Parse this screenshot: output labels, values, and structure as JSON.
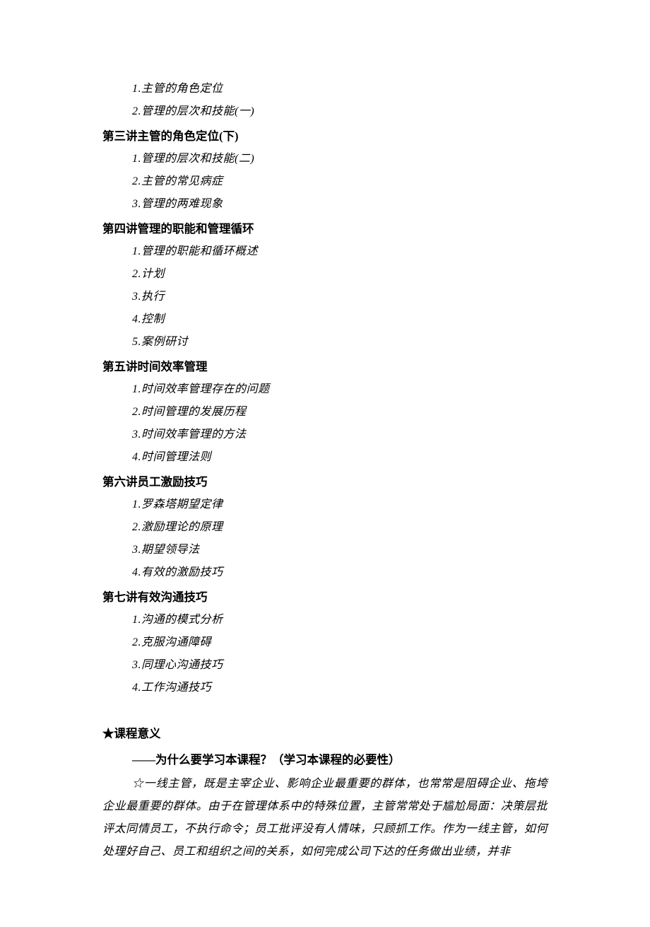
{
  "intro_items": [
    "1.主管的角色定位",
    "2.管理的层次和技能(一)"
  ],
  "sections": [
    {
      "heading": "第三讲主管的角色定位(下)",
      "items": [
        "1.管理的层次和技能(二)",
        "2.主管的常见病症",
        "3.管理的两难现象"
      ]
    },
    {
      "heading": "第四讲管理的职能和管理循环",
      "items": [
        "1.管理的职能和循环概述",
        "2.计划",
        "3.执行",
        "4.控制",
        "5.案例研讨"
      ]
    },
    {
      "heading": "第五讲时间效率管理",
      "items": [
        "1.时间效率管理存在的问题",
        "2.时间管理的发展历程",
        "3.时间效率管理的方法",
        "4.时间管理法则"
      ]
    },
    {
      "heading": "第六讲员工激励技巧",
      "items": [
        "1.罗森塔期望定律",
        "2.激励理论的原理",
        "3.期望领导法",
        "4.有效的激励技巧"
      ]
    },
    {
      "heading": "第七讲有效沟通技巧",
      "items": [
        "1.沟通的模式分析",
        "2.克服沟通障碍",
        "3.同理心沟通技巧",
        "4.工作沟通技巧"
      ]
    }
  ],
  "course_meaning": {
    "star_heading": "★课程意义",
    "sub_heading": "——为什么要学习本课程？（学习本课程的必要性）",
    "paragraph": "☆一线主管，既是主宰企业、影响企业最重要的群体，也常常是阻碍企业、拖垮企业最重要的群体。由于在管理体系中的特殊位置，主管常常处于尴尬局面：决策层批评太同情员工，不执行命令；员工批评没有人情味，只顾抓工作。作为一线主管，如何处理好自己、员工和组织之间的关系，如何完成公司下达的任务做出业绩，并非"
  }
}
